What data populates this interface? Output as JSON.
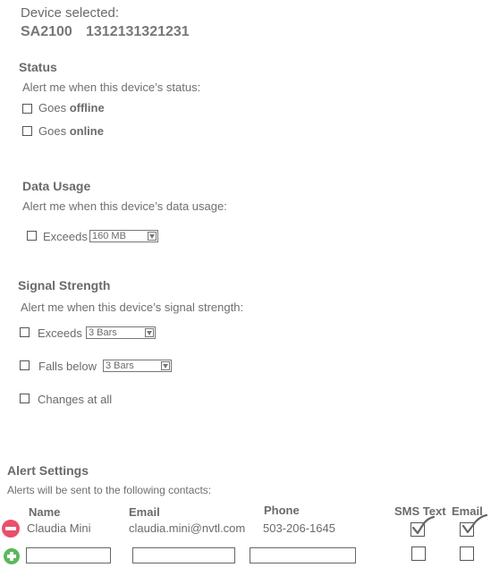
{
  "device": {
    "label": "Device selected:",
    "model": "SA2100",
    "serial": "1312131321231"
  },
  "status": {
    "title": "Status",
    "subtitle": "Alert me when this device’s status:",
    "offline_prefix": "Goes ",
    "offline_bold": "offline",
    "online_prefix": "Goes ",
    "online_bold": "online"
  },
  "data_usage": {
    "title": "Data Usage",
    "subtitle": "Alert me when this device’s data usage:",
    "exceeds_label": "Exceeds",
    "exceeds_value": "160 MB"
  },
  "signal": {
    "title": "Signal Strength",
    "subtitle": "Alert me when this device’s signal strength:",
    "exceeds_label": "Exceeds",
    "exceeds_value": "3 Bars",
    "falls_label": "Falls below",
    "falls_value": "3 Bars",
    "changes_label": "Changes at all"
  },
  "alerts": {
    "title": "Alert Settings",
    "subtitle": "Alerts will be sent to the following contacts:",
    "columns": {
      "name": "Name",
      "email": "Email",
      "phone": "Phone",
      "sms": "SMS Text",
      "email_check": "Email"
    },
    "contacts": [
      {
        "name": "Claudia Mini",
        "email": "claudia.mini@nvtl.com",
        "phone": "503-206-1645",
        "sms": true,
        "email_alert": true
      }
    ],
    "new_contact": {
      "name": "",
      "email": "",
      "phone": "",
      "sms": false,
      "email_alert": false
    }
  },
  "colors": {
    "remove": "#e8506b",
    "add": "#5bb85d",
    "text": "#6b6b6b"
  },
  "icons": {
    "remove": "minus-circle-icon",
    "add": "plus-circle-icon",
    "check": "checkmark-icon"
  }
}
